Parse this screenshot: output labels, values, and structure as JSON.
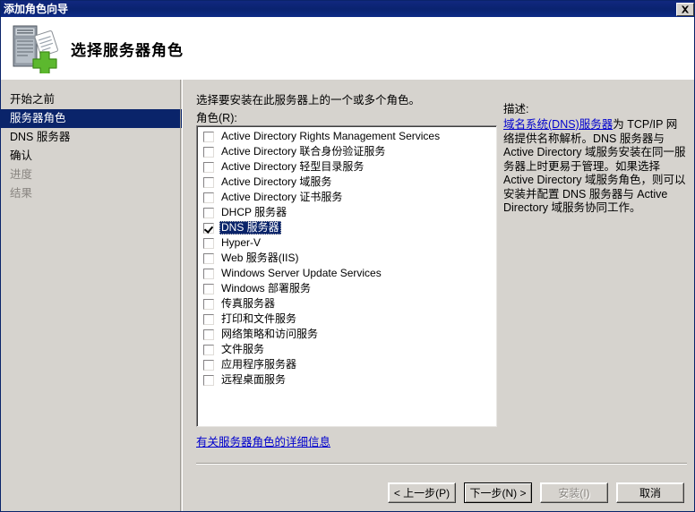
{
  "window": {
    "title": "添加角色向导",
    "close_icon": "close-icon"
  },
  "header": {
    "title": "选择服务器角色",
    "icon": "server-add-icon"
  },
  "sidebar": {
    "items": [
      {
        "label": "开始之前",
        "state": "normal"
      },
      {
        "label": "服务器角色",
        "state": "selected"
      },
      {
        "label": "DNS 服务器",
        "state": "normal"
      },
      {
        "label": "确认",
        "state": "normal"
      },
      {
        "label": "进度",
        "state": "disabled"
      },
      {
        "label": "结果",
        "state": "disabled"
      }
    ]
  },
  "main": {
    "instruction": "选择要安装在此服务器上的一个或多个角色。",
    "roles_label": "角色(R):",
    "more_info_link": "有关服务器角色的详细信息",
    "roles": [
      {
        "label": "Active Directory Rights Management Services",
        "checked": false,
        "selected": false
      },
      {
        "label": "Active Directory 联合身份验证服务",
        "checked": false,
        "selected": false
      },
      {
        "label": "Active Directory 轻型目录服务",
        "checked": false,
        "selected": false
      },
      {
        "label": "Active Directory 域服务",
        "checked": false,
        "selected": false
      },
      {
        "label": "Active Directory 证书服务",
        "checked": false,
        "selected": false
      },
      {
        "label": "DHCP 服务器",
        "checked": false,
        "selected": false
      },
      {
        "label": "DNS 服务器",
        "checked": true,
        "selected": true
      },
      {
        "label": "Hyper-V",
        "checked": false,
        "selected": false
      },
      {
        "label": "Web 服务器(IIS)",
        "checked": false,
        "selected": false
      },
      {
        "label": "Windows Server Update Services",
        "checked": false,
        "selected": false
      },
      {
        "label": "Windows 部署服务",
        "checked": false,
        "selected": false
      },
      {
        "label": "传真服务器",
        "checked": false,
        "selected": false
      },
      {
        "label": "打印和文件服务",
        "checked": false,
        "selected": false
      },
      {
        "label": "网络策略和访问服务",
        "checked": false,
        "selected": false
      },
      {
        "label": "文件服务",
        "checked": false,
        "selected": false
      },
      {
        "label": "应用程序服务器",
        "checked": false,
        "selected": false
      },
      {
        "label": "远程桌面服务",
        "checked": false,
        "selected": false
      }
    ]
  },
  "description": {
    "title": "描述:",
    "link_text": "域名系统(DNS)服务器",
    "body_text": "为 TCP/IP 网络提供名称解析。DNS 服务器与 Active Directory 域服务安装在同一服务器上时更易于管理。如果选择 Active Directory 域服务角色，则可以安装并配置 DNS 服务器与 Active Directory 域服务协同工作。"
  },
  "footer": {
    "buttons": [
      {
        "label": "< 上一步(P)",
        "state": "normal",
        "name": "back-button"
      },
      {
        "label": "下一步(N) >",
        "state": "default",
        "name": "next-button"
      },
      {
        "label": "安装(I)",
        "state": "disabled",
        "name": "install-button"
      },
      {
        "label": "取消",
        "state": "normal",
        "name": "cancel-button"
      }
    ]
  },
  "colors": {
    "titlebar": "#0a2370",
    "dialog_bg": "#d6d3ce",
    "selection": "#0a246a",
    "link": "#0000cd",
    "disabled_text": "#8a8681"
  }
}
